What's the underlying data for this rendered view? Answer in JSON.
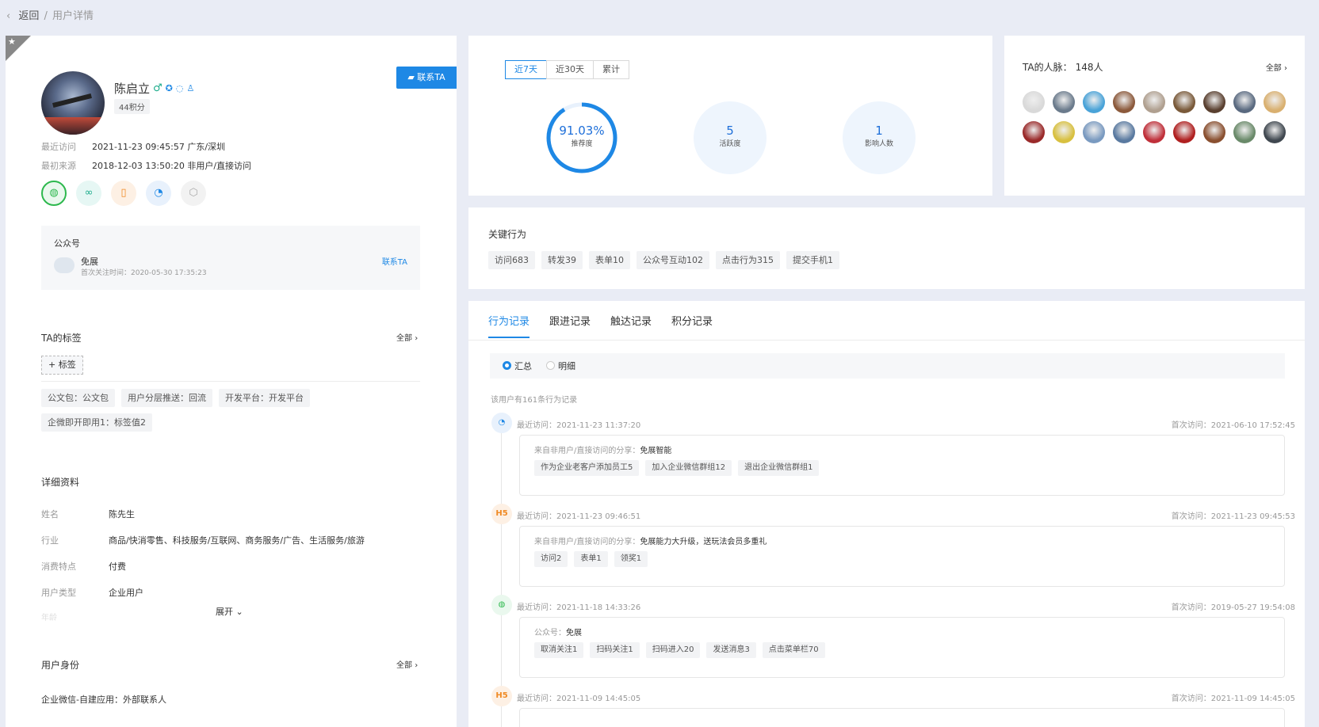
{
  "breadcrumb": {
    "back": "返回",
    "sep": "/",
    "current": "用户详情"
  },
  "profile": {
    "name": "陈启立",
    "points": "44积分",
    "contact_button": "联系TA",
    "recent_visit_label": "最近访问",
    "recent_visit_value": "2021-11-23 09:45:57  广东/深圳",
    "first_source_label": "最初来源",
    "first_source_value": "2018-12-03 13:50:20  非用户/直接访问",
    "channel_icons": [
      "wechat-icon",
      "link-icon",
      "mobile-icon",
      "visit-icon",
      "cube-icon"
    ]
  },
  "official_account": {
    "title": "公众号",
    "name": "免展",
    "follow_time": "首次关注时间：2020-05-30 17:35:23",
    "contact": "联系TA"
  },
  "tags": {
    "title": "TA的标签",
    "all": "全部",
    "add": "+ 标签",
    "items": [
      "公文包：公文包",
      "用户分层推送：回流",
      "开发平台：开发平台",
      "企微即开即用1：标签值2"
    ]
  },
  "details": {
    "title": "详细资料",
    "rows": [
      {
        "k": "姓名",
        "v": "陈先生"
      },
      {
        "k": "行业",
        "v": "商品/快消零售、科技服务/互联网、商务服务/广告、生活服务/旅游"
      },
      {
        "k": "消费特点",
        "v": "付费"
      },
      {
        "k": "用户类型",
        "v": "企业用户"
      }
    ],
    "faded_label": "年龄",
    "expand": "展开"
  },
  "identity": {
    "title": "用户身份",
    "all": "全部",
    "value": "企业微信-自建应用：外部联系人"
  },
  "stats": {
    "tabs": [
      "近7天",
      "近30天",
      "累计"
    ],
    "active_tab": 0,
    "recommend": {
      "value": "91.03%",
      "label": "推荐度",
      "fraction": 0.9103
    },
    "activity": {
      "value": "5",
      "label": "活跃度"
    },
    "influence": {
      "value": "1",
      "label": "影响人数"
    }
  },
  "network": {
    "title": "TA的人脉：",
    "count": "148人",
    "all": "全部",
    "avatar_colors": [
      "#d9d9d9",
      "#6b7b8c",
      "#4aa3d8",
      "#8c5a3c",
      "#b0a090",
      "#7a5a3a",
      "#5a4030",
      "#5a6a80",
      "#d9b070",
      "#9a2a2a",
      "#d8c040",
      "#7a9ac0",
      "#5a7aa0",
      "#c0303a",
      "#b02020",
      "#8a5030",
      "#6a8a6a",
      "#404850"
    ]
  },
  "key_behavior": {
    "title": "关键行为",
    "items": [
      "访问683",
      "转发39",
      "表单10",
      "公众号互动102",
      "点击行为315",
      "提交手机1"
    ]
  },
  "records": {
    "tabs": [
      "行为记录",
      "跟进记录",
      "触达记录",
      "积分记录"
    ],
    "active_tab": 0,
    "radio": [
      "汇总",
      "明细"
    ],
    "summary": "该用户有161条行为记录",
    "items": [
      {
        "icon": "visit",
        "recent": "最近访问：2021-11-23 11:37:20",
        "first": "首次访问：2021-06-10 17:52:45",
        "src_label": "来自非用户/直接访问的分享：",
        "src": "免展智能",
        "tags": [
          "作为企业老客户添加员工5",
          "加入企业微信群组12",
          "退出企业微信群组1"
        ]
      },
      {
        "icon": "H5",
        "recent": "最近访问：2021-11-23 09:46:51",
        "first": "首次访问：2021-11-23 09:45:53",
        "src_label": "来自非用户/直接访问的分享：",
        "src": "免展能力大升级，送玩法会员多重礼",
        "tags": [
          "访问2",
          "表单1",
          "领奖1"
        ]
      },
      {
        "icon": "wechat",
        "recent": "最近访问：2021-11-18 14:33:26",
        "first": "首次访问：2019-05-27 19:54:08",
        "src_label": "公众号：",
        "src": "免展",
        "tags": [
          "取消关注1",
          "扫码关注1",
          "扫码进入20",
          "发送消息3",
          "点击菜单栏70"
        ]
      },
      {
        "icon": "H5",
        "recent": "最近访问：2021-11-09 14:45:05",
        "first": "首次访问：2021-11-09 14:45:05"
      }
    ]
  }
}
